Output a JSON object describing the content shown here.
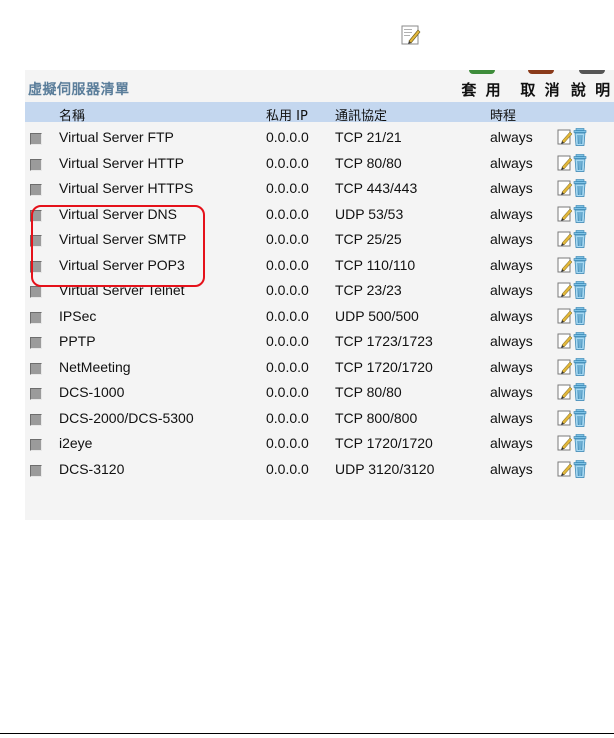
{
  "panel": {
    "title": "虛擬伺服器清單",
    "actions": [
      {
        "label": "套 用",
        "color": "#3d8c3a"
      },
      {
        "label": "取 消",
        "color": "#8a3a1a"
      },
      {
        "label": "說 明",
        "color": "#555555"
      }
    ]
  },
  "table": {
    "headers": {
      "name": "名稱",
      "ip": "私用 IP",
      "protocol": "通訊協定",
      "schedule": "時程"
    },
    "rows": [
      {
        "name": "Virtual Server FTP",
        "ip": "0.0.0.0",
        "protocol": "TCP 21/21",
        "schedule": "always"
      },
      {
        "name": "Virtual Server HTTP",
        "ip": "0.0.0.0",
        "protocol": "TCP 80/80",
        "schedule": "always"
      },
      {
        "name": "Virtual Server HTTPS",
        "ip": "0.0.0.0",
        "protocol": "TCP 443/443",
        "schedule": "always"
      },
      {
        "name": "Virtual Server DNS",
        "ip": "0.0.0.0",
        "protocol": "UDP 53/53",
        "schedule": "always"
      },
      {
        "name": "Virtual Server SMTP",
        "ip": "0.0.0.0",
        "protocol": "TCP 25/25",
        "schedule": "always"
      },
      {
        "name": "Virtual Server POP3",
        "ip": "0.0.0.0",
        "protocol": "TCP 110/110",
        "schedule": "always"
      },
      {
        "name": "Virtual Server Telnet",
        "ip": "0.0.0.0",
        "protocol": "TCP 23/23",
        "schedule": "always"
      },
      {
        "name": "IPSec",
        "ip": "0.0.0.0",
        "protocol": "UDP 500/500",
        "schedule": "always"
      },
      {
        "name": "PPTP",
        "ip": "0.0.0.0",
        "protocol": "TCP 1723/1723",
        "schedule": "always"
      },
      {
        "name": "NetMeeting",
        "ip": "0.0.0.0",
        "protocol": "TCP 1720/1720",
        "schedule": "always"
      },
      {
        "name": "DCS-1000",
        "ip": "0.0.0.0",
        "protocol": "TCP 80/80",
        "schedule": "always"
      },
      {
        "name": "DCS-2000/DCS-5300",
        "ip": "0.0.0.0",
        "protocol": "TCP 800/800",
        "schedule": "always"
      },
      {
        "name": "i2eye",
        "ip": "0.0.0.0",
        "protocol": "TCP 1720/1720",
        "schedule": "always"
      },
      {
        "name": "DCS-3120",
        "ip": "0.0.0.0",
        "protocol": "UDP 3120/3120",
        "schedule": "always"
      }
    ]
  },
  "highlight": {
    "color": "#e5111a"
  },
  "icons": {
    "top": "edit-icon",
    "row_edit": "edit-icon",
    "row_delete": "trash-icon"
  }
}
